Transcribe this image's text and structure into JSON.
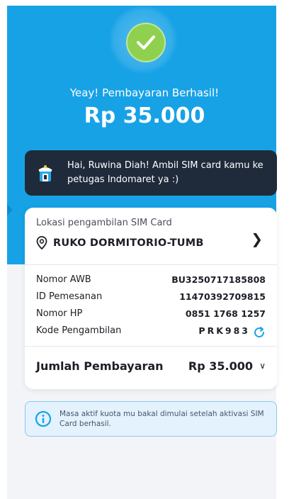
{
  "status": {
    "message": "Yeay! Pembayaran Berhasil!",
    "amount": "Rp 35.000"
  },
  "notice": {
    "text": "Hai, Ruwina Diah! Ambil SIM card kamu ke petugas Indomaret ya :)"
  },
  "location": {
    "label": "Lokasi pengambilan SIM Card",
    "name": "RUKO DORMITORIO-TUMB"
  },
  "details": [
    {
      "label": "Nomor AWB",
      "value": "BU3250717185808"
    },
    {
      "label": "ID Pemesanan",
      "value": "11470392709815"
    },
    {
      "label": "Nomor HP",
      "value": "0851 1768 1257"
    }
  ],
  "kode": {
    "label": "Kode Pengambilan",
    "value": "PRK983"
  },
  "total": {
    "label": "Jumlah Pembayaran",
    "value": "Rp 35.000"
  },
  "info": {
    "text": "Masa aktif kuota mu bakal dimulai setelah aktivasi SIM Card berhasil."
  },
  "colors": {
    "primary": "#17a2e6",
    "success": "#8fd14f",
    "dark": "#1f2b3a",
    "info_bg": "#e3f2fd"
  },
  "icons": [
    "check-icon",
    "store-icon",
    "location-pin-icon",
    "chevron-right-icon",
    "refresh-icon",
    "chevron-down-icon",
    "info-icon"
  ]
}
